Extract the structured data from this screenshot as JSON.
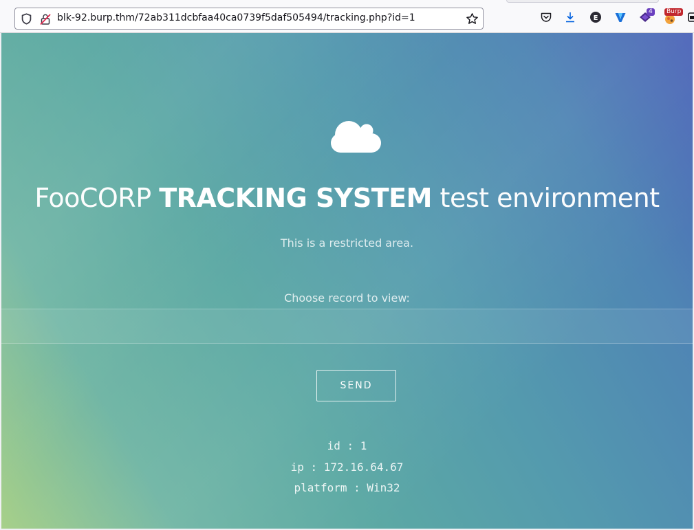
{
  "browser": {
    "url": "blk-92.burp.thm/72ab311dcbfaa40ca0739f5daf505494/tracking.php?id=1",
    "toolbar_icons": [
      "shield-icon",
      "insecure-lock-icon",
      "bookmark-star-icon",
      "pocket-icon",
      "download-icon",
      "extension-e-icon",
      "wappalyzer-icon",
      "foxyproxy-icon",
      "burp-icon",
      "extensions-overflow-icon"
    ],
    "extension_badge": "4",
    "burp_badge": "Burp"
  },
  "page": {
    "title_part1": "FooCORP",
    "title_part2": "TRACKING SYSTEM",
    "title_part3": "test environment",
    "subtitle": "This is a restricted area.",
    "choose_label": "Choose record to view:",
    "record_input_value": "",
    "send_label": "SEND",
    "results": [
      "id : 1",
      "ip : 172.16.64.67",
      "platform : Win32"
    ],
    "icon": "cloud-icon"
  }
}
